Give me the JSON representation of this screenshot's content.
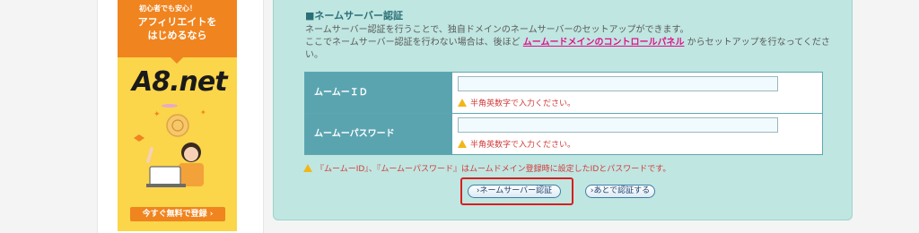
{
  "ad": {
    "tag": "初心者でも安心！",
    "headline_1": "アフィリエイトを",
    "headline_2": "はじめるなら",
    "logo": "A8.net",
    "cta": "今すぐ無料で登録 ›"
  },
  "section": {
    "title": "■ネームサーバー認証",
    "desc_line1": "ネームサーバー認証を行うことで、独自ドメインのネームサーバーのセットアップができます。",
    "desc_line2_pre": "ここでネームサーバー認証を行わない場合は、後ほど ",
    "desc_link": "ムームードメインのコントロールパネル",
    "desc_line2_post": " からセットアップを行なってください。"
  },
  "form": {
    "id_label": "ムームーＩＤ",
    "id_value": "",
    "id_hint": "半角英数字で入力ください。",
    "pw_label": "ムームーパスワード",
    "pw_value": "",
    "pw_hint": "半角英数字で入力ください。"
  },
  "note": "『ムームーID』、『ムームーパスワード』はムームドメイン登録時に設定したIDとパスワードです。",
  "buttons": {
    "auth": "ネームサーバー認証",
    "later": "あとで認証する"
  },
  "colors": {
    "panel_bg": "#bfe6e1",
    "label_bg": "#5aa4b0",
    "link": "#e0118c",
    "hint": "#d23a3a",
    "highlight": "#d81e1e"
  }
}
